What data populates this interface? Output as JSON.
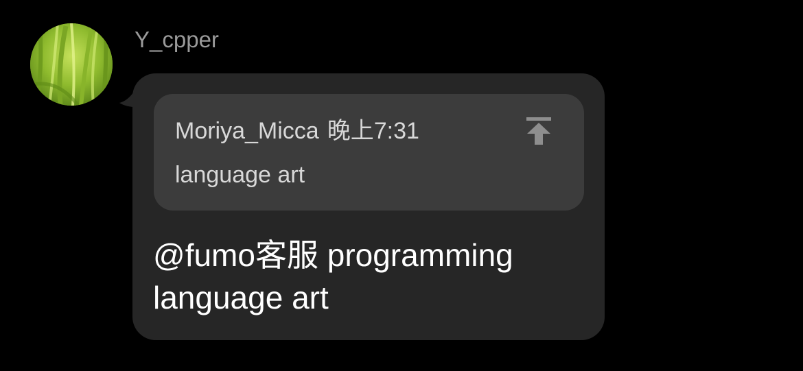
{
  "message": {
    "sender": {
      "name": "Y_cpper",
      "avatar_icon": "grass-photo-avatar"
    },
    "quote": {
      "author": "Moriya_Micca",
      "time": "晚上7:31",
      "text": "language art",
      "jump_icon": "jump-to-original-icon"
    },
    "text_line1": "@fumo客服 programming",
    "text_line2": "language art"
  },
  "colors": {
    "background": "#000000",
    "bubble": "#262626",
    "quote_background": "#3c3c3c",
    "sender_name": "#9a9a9a",
    "quote_text": "#d8d8d8",
    "message_text": "#ffffff"
  }
}
